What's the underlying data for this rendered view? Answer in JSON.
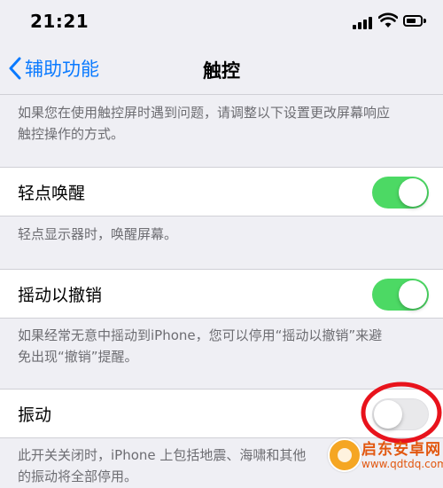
{
  "status_bar": {
    "time": "21:21"
  },
  "nav": {
    "back_label": "辅助功能",
    "title": "触控"
  },
  "intro": {
    "line1": "如果您在使用触控屏时遇到问题，请调整以下设置更改屏幕响应",
    "line2": "触控操作的方式。"
  },
  "settings": [
    {
      "label": "轻点唤醒",
      "state": "on",
      "footer_line1": "轻点显示器时，唤醒屏幕。",
      "footer_line2": ""
    },
    {
      "label": "摇动以撤销",
      "state": "on",
      "footer_line1": "如果经常无意中摇动到iPhone，您可以停用“摇动以撤销”来避",
      "footer_line2": "免出现“撤销”提醒。"
    },
    {
      "label": "振动",
      "state": "off",
      "footer_line1": "此开关关闭时，iPhone 上包括地震、海啸和其他",
      "footer_line2": "的振动将全部停用。"
    }
  ],
  "watermark": {
    "name": "启东安卓网",
    "url": "www.qdtdq.com"
  },
  "colors": {
    "accent": "#0a7aff",
    "toggle_on": "#4cd964",
    "annotation": "#e8131c"
  }
}
